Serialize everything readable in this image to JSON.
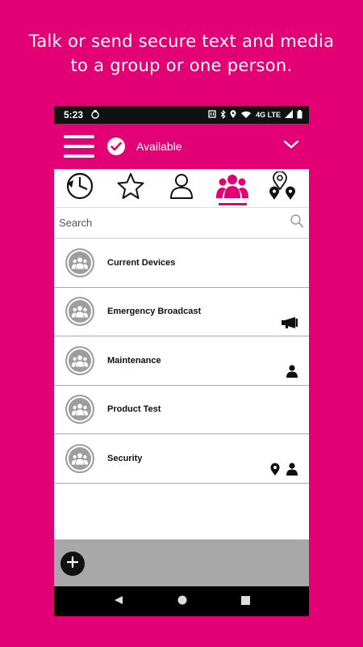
{
  "headline": {
    "line1": "Talk or send secure text and media",
    "line2": "to a group or one person."
  },
  "status_bar": {
    "time": "5:23",
    "network": "4G LTE"
  },
  "app_bar": {
    "status_label": "Available"
  },
  "tabs": [
    {
      "name": "recent",
      "icon": "history-icon",
      "active": false
    },
    {
      "name": "favorites",
      "icon": "star-icon",
      "active": false
    },
    {
      "name": "contacts",
      "icon": "person-icon",
      "active": false
    },
    {
      "name": "groups",
      "icon": "group-icon",
      "active": true
    },
    {
      "name": "map",
      "icon": "map-pin-icon",
      "active": false
    }
  ],
  "search": {
    "placeholder": "Search"
  },
  "groups": [
    {
      "label": "Current Devices",
      "badges": []
    },
    {
      "label": "Emergency Broadcast",
      "badges": [
        "megaphone-icon"
      ]
    },
    {
      "label": "Maintenance",
      "badges": [
        "person-icon"
      ]
    },
    {
      "label": "Product Test",
      "badges": []
    },
    {
      "label": "Security",
      "badges": [
        "location-pin-icon",
        "person-icon"
      ]
    }
  ],
  "colors": {
    "brand": "#E20074",
    "text": "#111111",
    "avatar": "#9E9E9E",
    "footer_gray": "#A8A8A8"
  }
}
